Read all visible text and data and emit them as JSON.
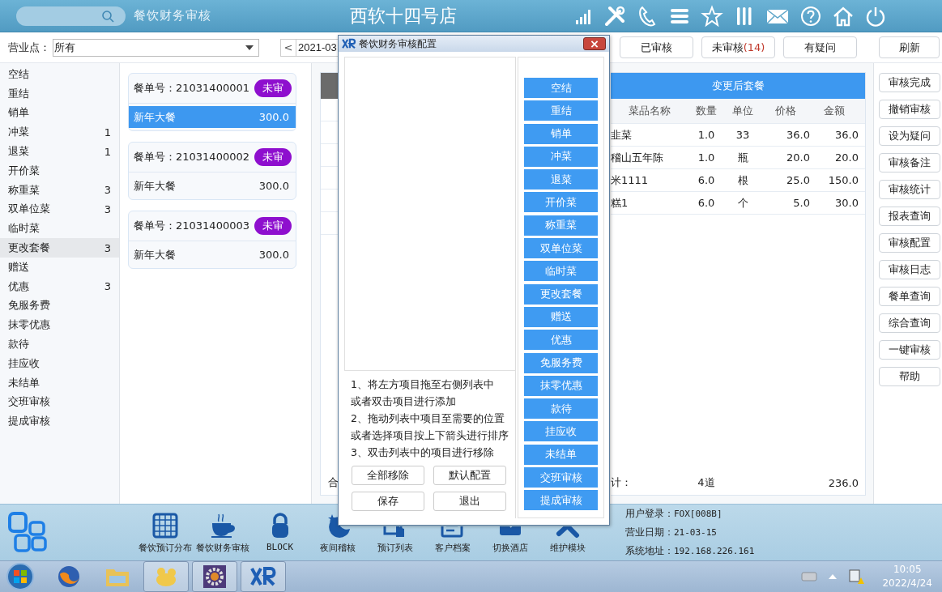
{
  "header": {
    "module_title": "餐饮财务审核",
    "store_name": "西软十四号店"
  },
  "toolbar": {
    "outlet_label": "营业点：",
    "outlet_value": "所有",
    "prev": "<",
    "date_value": "2021-03",
    "filters": [
      {
        "label": "已审核"
      },
      {
        "label": "未审核",
        "count": "(14)"
      },
      {
        "label": "有疑问"
      }
    ],
    "refresh": "刷新"
  },
  "categories": [
    {
      "label": "空结",
      "selected": false
    },
    {
      "label": "重结",
      "selected": false
    },
    {
      "label": "销单",
      "selected": false
    },
    {
      "label": "冲菜",
      "count": "1",
      "selected": false
    },
    {
      "label": "退菜",
      "count": "1",
      "selected": false
    },
    {
      "label": "开价菜",
      "selected": false
    },
    {
      "label": "称重菜",
      "count": "3",
      "selected": false
    },
    {
      "label": "双单位菜",
      "count": "3",
      "selected": false
    },
    {
      "label": "临时菜",
      "selected": false
    },
    {
      "label": "更改套餐",
      "count": "3",
      "selected": true
    },
    {
      "label": "赠送",
      "selected": false
    },
    {
      "label": "优惠",
      "count": "3",
      "selected": false
    },
    {
      "label": "免服务费",
      "selected": false
    },
    {
      "label": "抹零优惠",
      "selected": false
    },
    {
      "label": "款待",
      "selected": false
    },
    {
      "label": "挂应收",
      "selected": false
    },
    {
      "label": "未结单",
      "selected": false
    },
    {
      "label": "交班审核",
      "selected": false
    },
    {
      "label": "提成审核",
      "selected": false
    }
  ],
  "orders": [
    {
      "number": "餐单号：21031400001",
      "status": "未审",
      "items": [
        {
          "name": "新年大餐",
          "amount": "300.0",
          "selected": true
        }
      ]
    },
    {
      "number": "餐单号：21031400002",
      "status": "未审",
      "items": [
        {
          "name": "新年大餐",
          "amount": "300.0",
          "selected": false
        }
      ]
    },
    {
      "number": "餐单号：21031400003",
      "status": "未审",
      "items": [
        {
          "name": "新年大餐",
          "amount": "300.0",
          "selected": false
        }
      ]
    }
  ],
  "detail": {
    "before_total_label": "合",
    "after_title": "变更后套餐",
    "columns": [
      "菜品名称",
      "数量",
      "单位",
      "价格",
      "金额"
    ],
    "rows": [
      [
        "韭菜",
        "1.0",
        "33",
        "36.0",
        "36.0"
      ],
      [
        "稽山五年陈",
        "1.0",
        "瓶",
        "20.0",
        "20.0"
      ],
      [
        "米1111",
        "6.0",
        "根",
        "25.0",
        "150.0"
      ],
      [
        "糕1",
        "6.0",
        "个",
        "5.0",
        "30.0"
      ]
    ],
    "total": {
      "label": "计：",
      "count": "4道",
      "amount": "236.0"
    }
  },
  "actions": [
    "审核完成",
    "撤销审核",
    "设为疑问",
    "审核备注",
    "审核统计",
    "报表查询",
    "审核配置",
    "审核日志",
    "餐单查询",
    "综合查询",
    "一键审核",
    "帮助"
  ],
  "dialog": {
    "title": "餐饮财务审核配置",
    "instructions": [
      "1、将左方项目拖至右侧列表中",
      "或者双击项目进行添加",
      "2、拖动列表中项目至需要的位置",
      "或者选择项目按上下箭头进行排序",
      "3、双击列表中的项目进行移除"
    ],
    "buttons": [
      "全部移除",
      "默认配置",
      "保存",
      "退出"
    ],
    "items": [
      "空结",
      "重结",
      "销单",
      "冲菜",
      "退菜",
      "开价菜",
      "称重菜",
      "双单位菜",
      "临时菜",
      "更改套餐",
      "赠送",
      "优惠",
      "免服务费",
      "抹零优惠",
      "款待",
      "挂应收",
      "未结单",
      "交班审核",
      "提成审核"
    ]
  },
  "dock": {
    "items": [
      "餐饮预订分布",
      "餐饮财务审核",
      "BLOCK",
      "夜间稽核",
      "预订列表",
      "客户档案",
      "切换酒店",
      "维护模块"
    ],
    "info": [
      {
        "label": "用户登录：",
        "value": "FOX[008B]"
      },
      {
        "label": "营业日期：",
        "value": "21-03-15"
      },
      {
        "label": "系统地址：",
        "value": "192.168.226.161"
      }
    ]
  },
  "taskbar": {
    "time": "10:05",
    "date": "2022/4/24"
  }
}
